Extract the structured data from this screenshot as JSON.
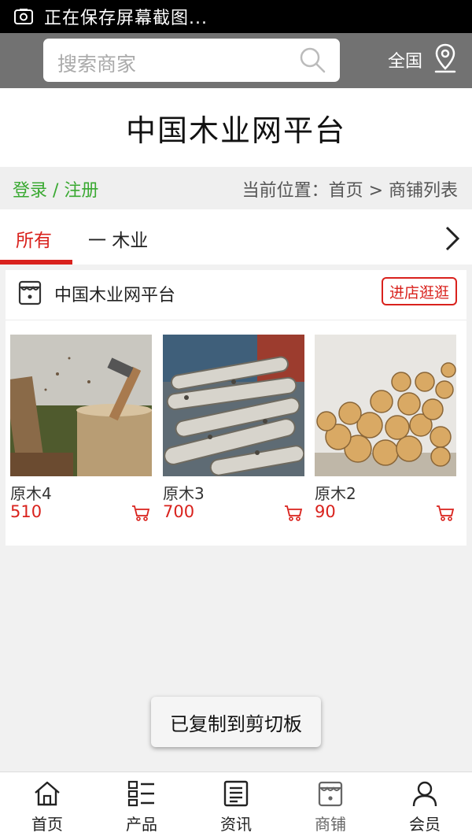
{
  "status_bar": {
    "text": "正在保存屏幕截图..."
  },
  "header": {
    "search_placeholder": "搜索商家",
    "region": "全国"
  },
  "site_title": "中国木业网平台",
  "breadcrumb": {
    "login": "登录 / 注册",
    "location": "当前位置：首页 > 商铺列表"
  },
  "tabs": [
    {
      "label": "所有"
    },
    {
      "label": "一 木业"
    }
  ],
  "shop": {
    "name": "中国木业网平台",
    "visit_label": "进店逛逛",
    "products": [
      {
        "name": "原木4",
        "price": "510"
      },
      {
        "name": "原木3",
        "price": "700"
      },
      {
        "name": "原木2",
        "price": "90"
      }
    ]
  },
  "toast": "已复制到剪切板",
  "bottom_nav": [
    {
      "label": "首页",
      "icon": "home-icon"
    },
    {
      "label": "产品",
      "icon": "list-icon"
    },
    {
      "label": "资讯",
      "icon": "news-icon"
    },
    {
      "label": "商铺",
      "icon": "store-icon"
    },
    {
      "label": "会员",
      "icon": "user-icon"
    }
  ],
  "colors": {
    "accent": "#d9221d",
    "login": "#3aa932",
    "header": "#727272"
  }
}
